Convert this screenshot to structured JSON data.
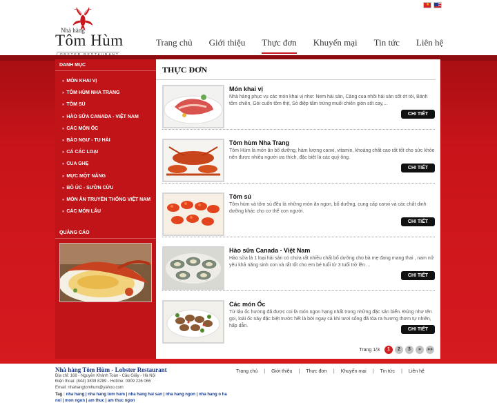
{
  "header": {
    "logo_small": "Nhà hàng",
    "logo_main": "Tôm Hùm",
    "logo_tag": "LOBSTER RESTAURANT"
  },
  "nav": [
    {
      "label": "Trang chủ"
    },
    {
      "label": "Giới thiệu"
    },
    {
      "label": "Thực đơn",
      "active": true
    },
    {
      "label": "Khuyến mại"
    },
    {
      "label": "Tin tức"
    },
    {
      "label": "Liên hệ"
    }
  ],
  "sidebar": {
    "heading": "DANH MỤC",
    "items": [
      "MÓN KHAI VỊ",
      "TÔM HÙM NHA TRANG",
      "TÔM SÚ",
      "HÀO SỮA CANADA - VIỆT NAM",
      "CÁC MÓN ỐC",
      "BÀO NGƯ - TU HÀI",
      "CÁ CÁC LOẠI",
      "CUA GHẸ",
      "MỰC MỘT NẮNG",
      "BÒ ÚC - SƯỜN CỪU",
      "MÓN ĂN TRUYỀN THỐNG VIỆT NAM",
      "CÁC MÓN LẨU"
    ],
    "ad_heading": "QUẢNG CÁO"
  },
  "content": {
    "title": "THỰC ĐƠN",
    "button_label": "CHI TIẾT",
    "items": [
      {
        "title": "Món khai vị",
        "desc": "Nhà hàng phục vụ các món khai vị như: Nem hải sản, Càng cua nhồi hải sản sốt ớt tỏi, Bánh tôm chiên, Gỏi cuốn tôm thịt, Sò điệp tẩm trứng muối chiên giòn sốt cay,...",
        "thumb": "appetizer"
      },
      {
        "title": "Tôm hùm Nha Trang",
        "desc": "Tôm Hùm là món ăn bổ dưỡng, hàm lượng canxi, vitamin, khoáng chất cao rất tốt cho sức khỏe nên được nhiều người ưa thích, đặc biệt là các quý ông.",
        "thumb": "lobster"
      },
      {
        "title": "Tôm sú",
        "desc": "Tôm hùm và tôm sú đều là những món ăn ngon, bổ dưỡng, cung cấp canxi và các chất dinh dưỡng khác cho cơ thể con người.",
        "thumb": "shrimp"
      },
      {
        "title": "Hào sữa Canada - Việt Nam",
        "desc": "Hào sữa là 1 loại hải sản có chứa rất nhiều chất bổ dưỡng cho bà mẹ đang mang thai , nam nữ yêu khả năng sinh con và rất tốt cho em bé tuổi từ 3 tuổi trở lên ...",
        "thumb": "oyster"
      },
      {
        "title": "Các món Ốc",
        "desc": "Từ lâu ốc hương đã được coi là món ngon hạng nhất trong những đặc sản biển. Đúng như tên gọi, loài ốc này đặc biệt trước hết là bởi ngay cả khi tươi sống đã tỏa ra hương thơm tự nhiên, hấp dẫn.",
        "thumb": "snail"
      }
    ],
    "pager": {
      "label": "Trang 1/3",
      "pages": [
        "1",
        "2",
        "3"
      ],
      "next": "»",
      "last": "»»"
    }
  },
  "footer": {
    "name": "Nhà hàng Tôm Hùm - Lobster Restaurant",
    "address": "Địa chỉ: 168 - Nguyễn Khánh Toàn - Cầu Giấy - Hà Nội",
    "phone": "Điện thoại: (844) 3839 8289 - Hotline: 0909 226 066",
    "email": "Email: nhahangtomhum@yahoo.com",
    "tags_label": "Tag :",
    "tags": [
      "nha hang",
      "nha hang tom hum",
      "nha hang hai san",
      "nha hang ngon",
      "nha hang o ha noi",
      "mon ngon",
      "am thuc",
      "am thuc ngon"
    ],
    "nav": [
      "Trang chủ",
      "Giới thiệu",
      "Thực đơn",
      "Khuyến mại",
      "Tin tức",
      "Liên hệ"
    ]
  }
}
